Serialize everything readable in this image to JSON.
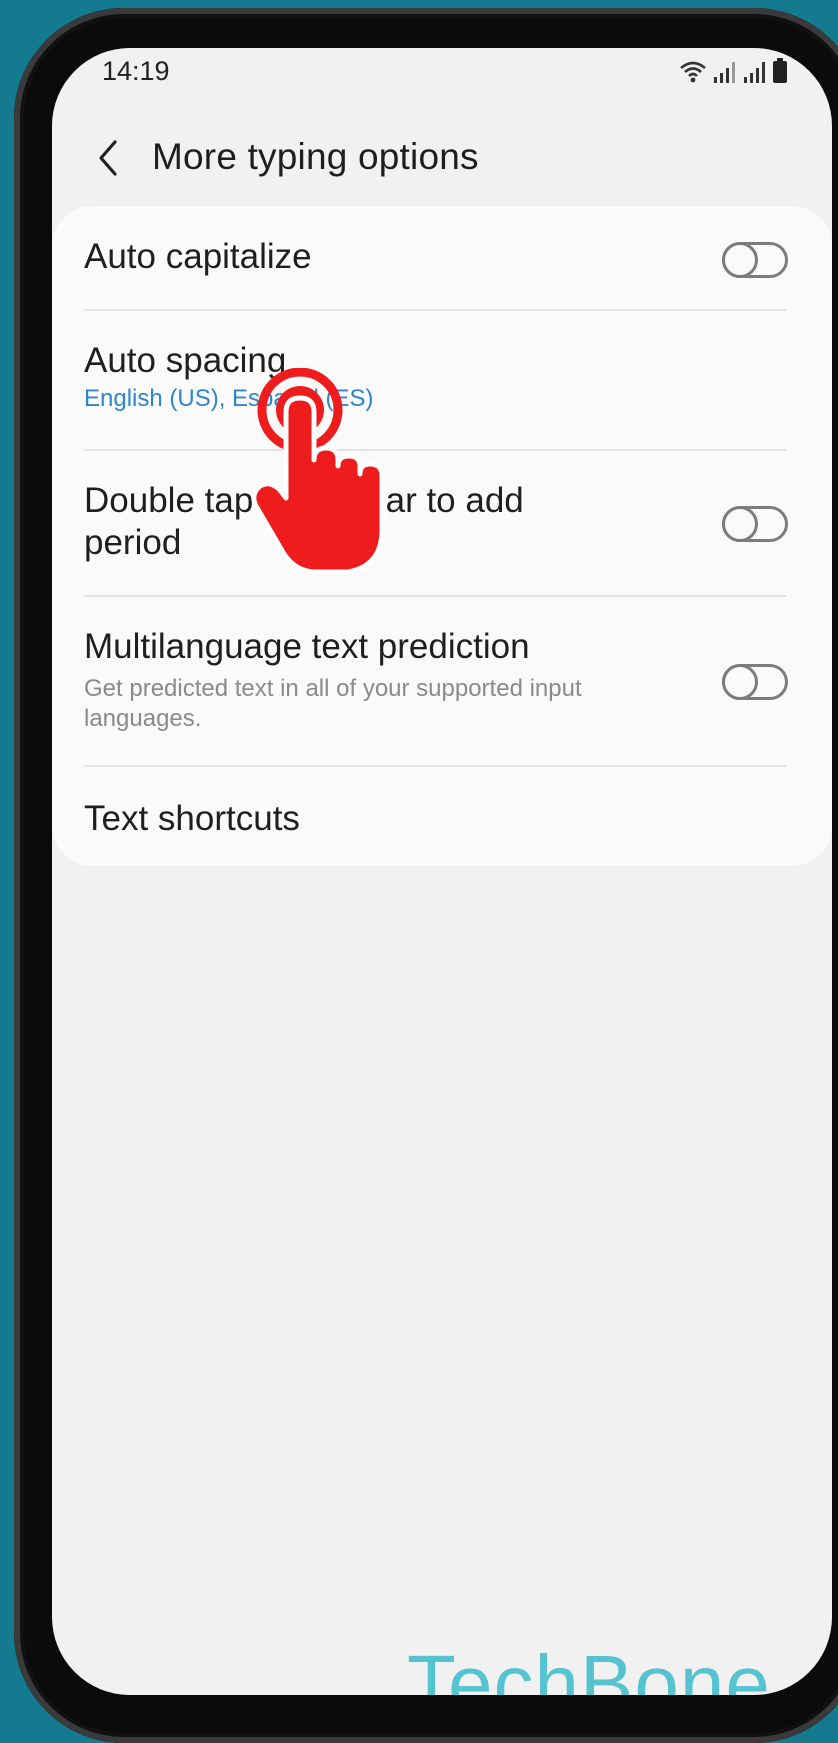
{
  "status_bar": {
    "time": "14:19"
  },
  "header": {
    "title": "More typing options",
    "back_icon": "chevron-left-icon"
  },
  "settings": [
    {
      "title": "Auto capitalize",
      "toggle": false
    },
    {
      "title": "Auto spacing",
      "subtitle": "English (US), Español (ES)"
    },
    {
      "title": "Double tap space bar to add period",
      "toggle": false
    },
    {
      "title": "Multilanguage text prediction",
      "subtitle": "Get predicted text in all of your supported input languages.",
      "toggle": false
    },
    {
      "title": "Text shortcuts"
    }
  ],
  "watermark": "TechBone",
  "colors": {
    "background": "#137a8f",
    "accent_subtitle": "#2f86c8",
    "tap_indicator": "#ee1c1c",
    "watermark": "#55c3d0"
  }
}
